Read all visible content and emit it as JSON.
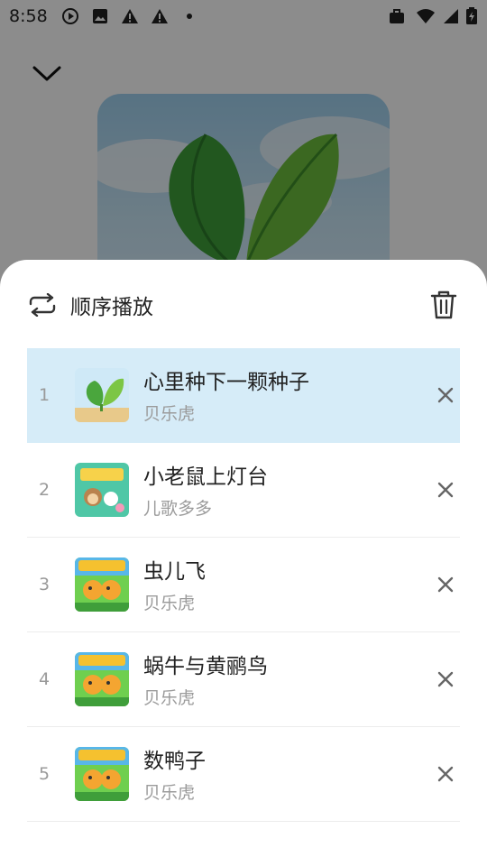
{
  "status_bar": {
    "time": "8:58",
    "left_icons": [
      "play-circle-icon",
      "image-icon",
      "warning-icon",
      "warning-icon",
      "dot-icon"
    ],
    "right_icons": [
      "briefcase-icon",
      "wifi-icon",
      "signal-icon",
      "battery-charging-icon"
    ]
  },
  "player": {
    "collapse_icon": "chevron-down-icon"
  },
  "sheet": {
    "play_mode_label": "顺序播放",
    "play_mode_icon": "repeat-icon",
    "clear_icon": "trash-icon"
  },
  "playlist": [
    {
      "index": "1",
      "title": "心里种下一颗种子",
      "artist": "贝乐虎",
      "active": true,
      "thumb": "sprout"
    },
    {
      "index": "2",
      "title": "小老鼠上灯台",
      "artist": "儿歌多多",
      "active": false,
      "thumb": "kids"
    },
    {
      "index": "3",
      "title": "虫儿飞",
      "artist": "贝乐虎",
      "active": false,
      "thumb": "tiger"
    },
    {
      "index": "4",
      "title": "蜗牛与黄鹂鸟",
      "artist": "贝乐虎",
      "active": false,
      "thumb": "tiger"
    },
    {
      "index": "5",
      "title": "数鸭子",
      "artist": "贝乐虎",
      "active": false,
      "thumb": "tiger"
    }
  ],
  "colors": {
    "active_row": "#d6ecf8",
    "scrim": "rgba(0,0,0,0.45)"
  }
}
